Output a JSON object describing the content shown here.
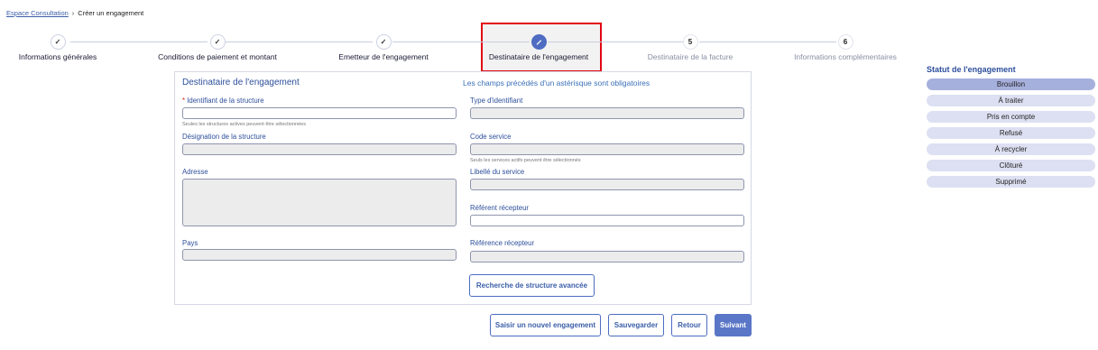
{
  "breadcrumb": {
    "link": "Espace Consultation",
    "separator": "›",
    "current": "Créer un engagement"
  },
  "stepper": {
    "steps": [
      {
        "label": "Informations générales",
        "state": "done",
        "marker": "✓"
      },
      {
        "label": "Conditions de paiement et montant",
        "state": "done",
        "marker": "✓"
      },
      {
        "label": "Emetteur de l'engagement",
        "state": "done",
        "marker": "✓"
      },
      {
        "label": "Destinataire de l'engagement",
        "state": "active",
        "marker": "pencil-icon"
      },
      {
        "label": "Destinataire de la facture",
        "state": "todo",
        "marker": "5"
      },
      {
        "label": "Informations complémentaires",
        "state": "todo",
        "marker": "6"
      }
    ]
  },
  "form": {
    "title": "Destinataire de l'engagement",
    "required_note": "Les champs précédés d'un astérisque sont obligatoires",
    "left": {
      "identifiant_label": "Identifiant de la structure",
      "identifiant_required": "*",
      "identifiant_hint": "Seules les structures actives peuvent être sélectionnées",
      "designation_label": "Désignation de la structure",
      "adresse_label": "Adresse",
      "pays_label": "Pays"
    },
    "right": {
      "type_label": "Type d'identifiant",
      "code_service_label": "Code service",
      "code_service_hint": "Seuls les services actifs peuvent être sélectionnés",
      "libelle_label": "Libellé du service",
      "referent_label": "Référent récepteur",
      "reference_label": "Référence récepteur"
    },
    "advanced_search_button": "Recherche de structure avancée"
  },
  "actions": {
    "new": "Saisir un nouvel engagement",
    "save": "Sauvegarder",
    "back": "Retour",
    "next": "Suivant"
  },
  "status": {
    "title": "Statut de l'engagement",
    "items": [
      "Brouillon",
      "À traiter",
      "Pris en compte",
      "Refusé",
      "À recycler",
      "Clôturé",
      "Supprimé"
    ],
    "current": "Brouillon"
  },
  "colors": {
    "accent": "#4e6cc1",
    "highlight_border": "#e20613",
    "label": "#2d4f9b"
  }
}
